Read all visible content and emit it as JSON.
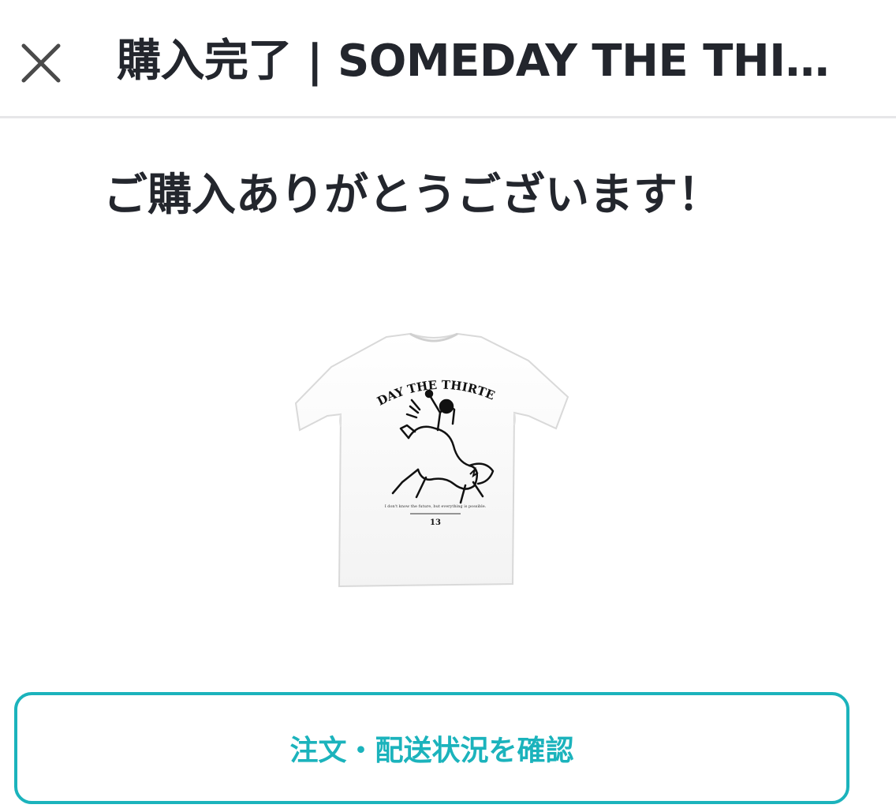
{
  "header": {
    "title": "購入完了 | SOMEDAY THE THIRTEENTH",
    "close_icon": "close-icon"
  },
  "main": {
    "thanks_message": "ご購入ありがとうございます！",
    "product_image": {
      "print_title": "SOMEDAY THE THIRTEENTH",
      "print_tagline": "I don't know the future, but everything is possible.",
      "print_logo": "13"
    }
  },
  "actions": {
    "order_status_label": "注文・配送状況を確認"
  },
  "colors": {
    "accent": "#1bb3bc",
    "text": "#23262d",
    "divider": "#e6e6e8"
  }
}
